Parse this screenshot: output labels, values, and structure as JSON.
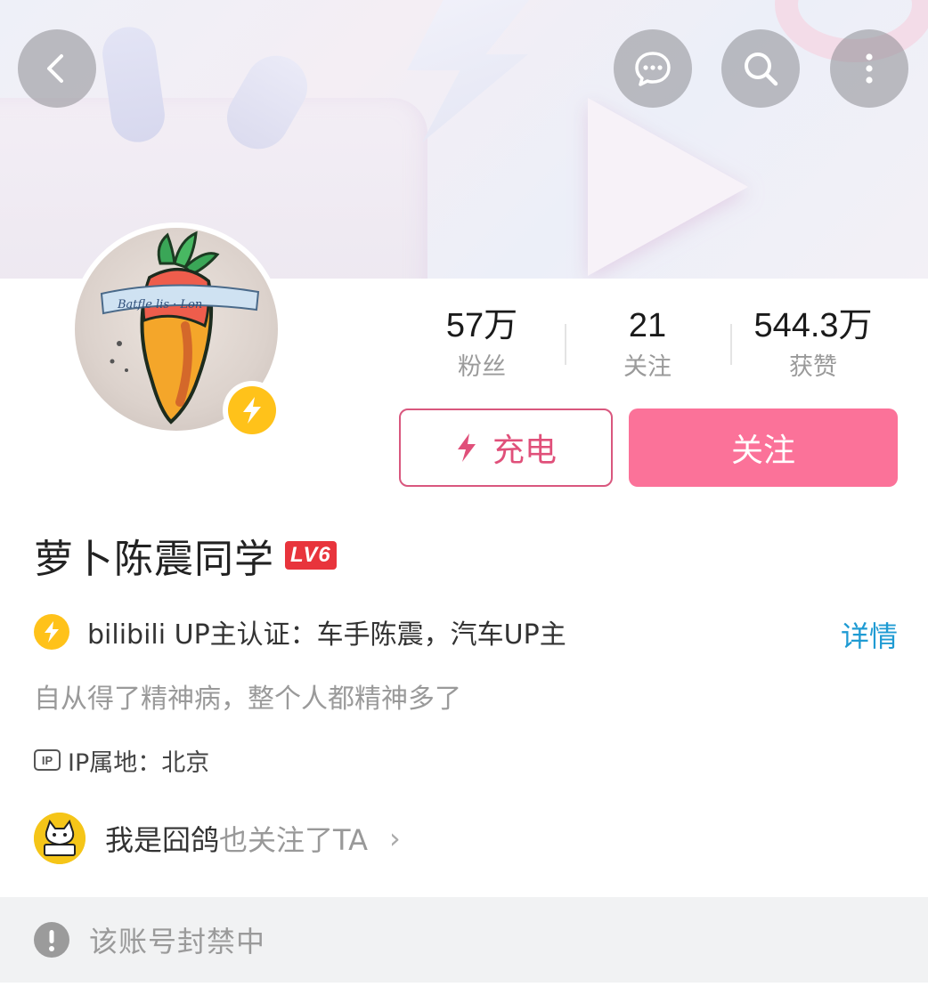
{
  "colors": {
    "accent": "#fb7299",
    "charge_border": "#d9577e",
    "link": "#1f9bd3",
    "badge_yellow": "#ffc21a",
    "level_red": "#e8343c"
  },
  "topbar": {
    "back_icon": "chevron-left-icon",
    "message_icon": "message-icon",
    "search_icon": "search-icon",
    "more_icon": "more-vertical-icon"
  },
  "profile": {
    "avatar_icon": "carrot-avatar",
    "badge_icon": "lightning-icon",
    "name": "萝卜陈震同学",
    "level": "LV6"
  },
  "stats": [
    {
      "value": "57万",
      "label": "粉丝"
    },
    {
      "value": "21",
      "label": "关注"
    },
    {
      "value": "544.3万",
      "label": "获赞"
    }
  ],
  "actions": {
    "charge_label": "充电",
    "follow_label": "关注"
  },
  "verification": {
    "text": "bilibili UP主认证：车手陈震，汽车UP主",
    "detail_label": "详情"
  },
  "bio": "自从得了精神病，整个人都精神多了",
  "ip": {
    "badge": "IP",
    "text": "IP属地：北京"
  },
  "mutual": {
    "name": "我是囧鸽",
    "suffix": "也关注了TA",
    "chevron": "›"
  },
  "banned": {
    "text": "该账号封禁中"
  }
}
